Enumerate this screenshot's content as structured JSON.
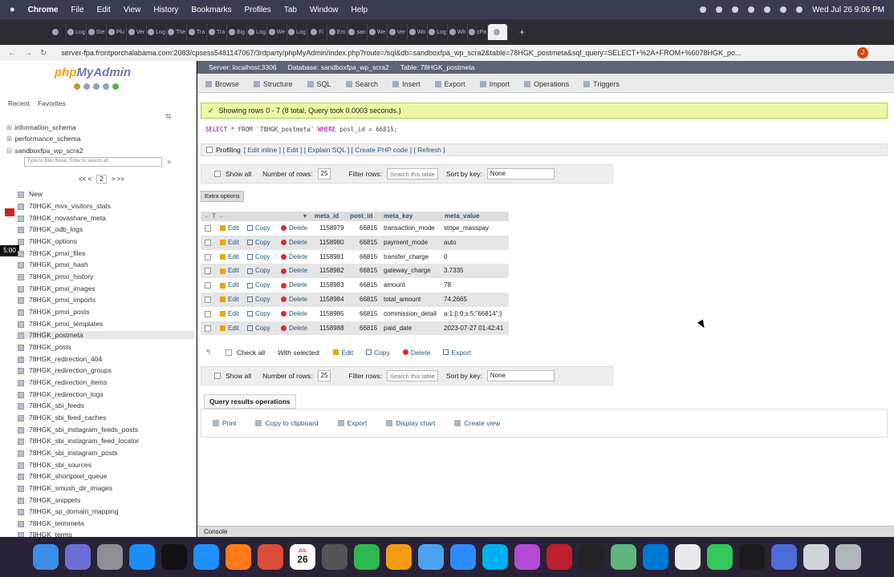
{
  "menubar": {
    "app": "Chrome",
    "items": [
      "File",
      "Edit",
      "View",
      "History",
      "Bookmarks",
      "Profiles",
      "Tab",
      "Window",
      "Help"
    ],
    "clock": "Wed Jul 26  9:06 PM"
  },
  "tabs": [
    "",
    "Log",
    "Ste",
    "Plu",
    "Ver",
    "Log",
    "The",
    "Tra",
    "Tra",
    "Big",
    "Log",
    "We",
    "Log",
    "Fi",
    "Em",
    "san",
    "We",
    "Ver",
    "Wo",
    "Log",
    "Wh",
    "cPa",
    ""
  ],
  "address": {
    "url": "server-fpa.frontporchalabama.com:2083/cpsess5481147067/3rdparty/phpMyAdmin/index.php?route=/sql&db=sandboxfpa_wp_scra2&table=78HGK_postmeta&sql_query=SELECT+%2A+FROM+%6078HGK_po...",
    "avatar": "J"
  },
  "sidebar": {
    "logo_a": "php",
    "logo_b": "MyAdmin",
    "tabs": [
      "Recent",
      "Favorites"
    ],
    "dbs": [
      "information_schema",
      "performance_schema",
      "sandboxfpa_wp_scra2"
    ],
    "filter_placeholder": "Type to filter these, Enter to search all",
    "pager": {
      "prev": "<< <",
      "page": "2",
      "next": "> >>"
    },
    "time": "5:00",
    "new": "New",
    "tables": [
      "78HGK_mvx_visitors_stats",
      "78HGK_novashare_meta",
      "78HGK_odb_logs",
      "78HGK_options",
      "78HGK_pmxi_files",
      "78HGK_pmxi_hash",
      "78HGK_pmxi_history",
      "78HGK_pmxi_images",
      "78HGK_pmxi_imports",
      "78HGK_pmxi_posts",
      "78HGK_pmxi_templates",
      "78HGK_postmeta",
      "78HGK_posts",
      "78HGK_redirection_404",
      "78HGK_redirection_groups",
      "78HGK_redirection_items",
      "78HGK_redirection_logs",
      "78HGK_sbi_feeds",
      "78HGK_sbi_feed_caches",
      "78HGK_sbi_instagram_feeds_posts",
      "78HGK_sbi_instagram_feed_locator",
      "78HGK_sbi_instagram_posts",
      "78HGK_sbi_sources",
      "78HGK_shortpixel_queue",
      "78HGK_smush_dir_images",
      "78HGK_snippets",
      "78HGK_sp_domain_mapping",
      "78HGK_termmeta",
      "78HGK_terms"
    ]
  },
  "breadcrumb": [
    "Server: localhost:3306",
    "Database: sandboxfpa_wp_scra2",
    "Table: 78HGK_postmeta"
  ],
  "toolbar": [
    "Browse",
    "Structure",
    "SQL",
    "Search",
    "Insert",
    "Export",
    "Import",
    "Operations",
    "Triggers"
  ],
  "result": {
    "message": "Showing rows 0 - 7 (8 total, Query took 0.0003 seconds.)"
  },
  "sql": {
    "select": "SELECT",
    "rest1": " * FROM `78HGK_postmeta` ",
    "where": "WHERE",
    "rest2": " post_id = 66815;"
  },
  "profiling": {
    "label": "Profiling",
    "links": "[ Edit inline ] [ Edit ] [ Explain SQL ] [ Create PHP code ] [ Refresh ]"
  },
  "nav": {
    "show_all": "Show all",
    "num_rows_label": "Number of rows:",
    "num_rows": "25",
    "filter_label": "Filter rows:",
    "filter_placeholder": "Search this table",
    "sort_label": "Sort by key:",
    "sort": "None"
  },
  "extra_options": "Extra options",
  "columns": [
    "meta_id",
    "post_id",
    "meta_key",
    "meta_value"
  ],
  "actions": {
    "edit": "Edit",
    "copy": "Copy",
    "delete": "Delete"
  },
  "rows": [
    {
      "meta_id": "1158979",
      "post_id": "66815",
      "meta_key": "transaction_mode",
      "meta_value": "stripe_masspay"
    },
    {
      "meta_id": "1158980",
      "post_id": "66815",
      "meta_key": "payment_mode",
      "meta_value": "auto"
    },
    {
      "meta_id": "1158981",
      "post_id": "66815",
      "meta_key": "transfer_charge",
      "meta_value": "0"
    },
    {
      "meta_id": "1158982",
      "post_id": "66815",
      "meta_key": "gateway_charge",
      "meta_value": "3.7335"
    },
    {
      "meta_id": "1158983",
      "post_id": "66815",
      "meta_key": "amount",
      "meta_value": "78"
    },
    {
      "meta_id": "1158984",
      "post_id": "66815",
      "meta_key": "total_amount",
      "meta_value": "74.2665"
    },
    {
      "meta_id": "1158985",
      "post_id": "66815",
      "meta_key": "commission_detail",
      "meta_value": "a:1:{i:0;s:5:\"66814\";}"
    },
    {
      "meta_id": "1158988",
      "post_id": "66815",
      "meta_key": "paid_date",
      "meta_value": "2023-07-27 01:42:41"
    }
  ],
  "bulk": {
    "check_all": "Check all",
    "with_selected": "With selected:",
    "edit": "Edit",
    "copy": "Copy",
    "delete": "Delete",
    "export": "Export"
  },
  "query_ops": {
    "title": "Query results operations",
    "items": [
      "Print",
      "Copy to clipboard",
      "Export",
      "Display chart",
      "Create view"
    ]
  },
  "console": "Console",
  "dock": [
    "Finder",
    "Launchpad",
    "Settings",
    "App Store",
    "TV",
    "Safari",
    "Firefox",
    "Chrome",
    "Calendar",
    "Calculator",
    "Numbers",
    "Pages",
    "Mail",
    "Zoom",
    "Skype",
    "Affinity",
    "FileZilla",
    "Terminal",
    "Atom",
    "VS Code",
    "TextEdit",
    "FaceTime",
    "Monitor",
    "Settings2",
    "Folder",
    "Trash"
  ],
  "calendar": {
    "month": "JUL",
    "day": "26"
  }
}
